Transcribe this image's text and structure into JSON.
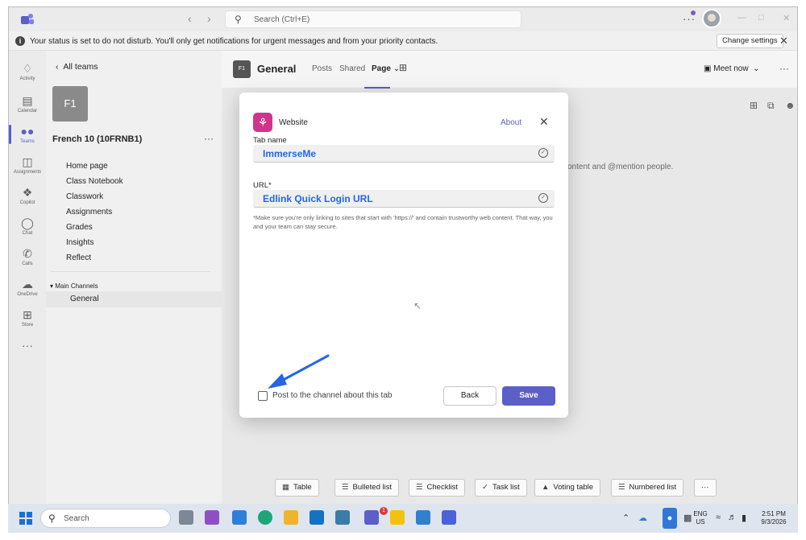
{
  "titlebar": {
    "search_placeholder": "Search (Ctrl+E)",
    "more": "···"
  },
  "banner": {
    "message": "Your status is set to do not disturb. You'll only get notifications for urgent messages and from your priority contacts.",
    "change_settings": "Change settings"
  },
  "rail": {
    "items": [
      {
        "label": "Activity",
        "icon": "bell-icon"
      },
      {
        "label": "Calendar",
        "icon": "calendar-icon"
      },
      {
        "label": "Teams",
        "icon": "teams-icon"
      },
      {
        "label": "Assignments",
        "icon": "backpack-icon"
      },
      {
        "label": "Copilot",
        "icon": "copilot-icon"
      },
      {
        "label": "Chat",
        "icon": "chat-icon"
      },
      {
        "label": "Calls",
        "icon": "phone-icon"
      },
      {
        "label": "OneDrive",
        "icon": "cloud-icon"
      },
      {
        "label": "Store",
        "icon": "plus-icon"
      }
    ],
    "more": "···"
  },
  "team_panel": {
    "all_teams": "All teams",
    "tile": "F1",
    "team_name": "French 10 (10FRNB1)",
    "more": "···",
    "items": [
      "Home page",
      "Class Notebook",
      "Classwork",
      "Assignments",
      "Grades",
      "Insights",
      "Reflect"
    ],
    "main_channels": "Main Channels",
    "channel": "General"
  },
  "channel_header": {
    "tile": "F1",
    "title": "General",
    "tabs": [
      "Posts",
      "Shared",
      "Page"
    ],
    "meet_now": "Meet now",
    "more": "···"
  },
  "background_text": "ontent and @mention people.",
  "format_bar": [
    {
      "label": "Table",
      "icon": "table-icon"
    },
    {
      "label": "Bulleted list",
      "icon": "bullet-list-icon"
    },
    {
      "label": "Checklist",
      "icon": "checklist-icon"
    },
    {
      "label": "Task list",
      "icon": "task-list-icon"
    },
    {
      "label": "Voting table",
      "icon": "voting-icon"
    },
    {
      "label": "Numbered list",
      "icon": "numbered-list-icon"
    },
    {
      "label": "···",
      "icon": "more-icon"
    }
  ],
  "dialog": {
    "title": "Website",
    "about": "About",
    "tab_name_label": "Tab name",
    "tab_name_value": "ImmerseMe",
    "url_label": "URL*",
    "url_value": "Edlink Quick Login URL",
    "help_text": "*Make sure you're only linking to sites that start with 'https://' and contain trustworthy web content. That way, you and your team can stay secure.",
    "checkbox_label": "Post to the channel about this tab",
    "back": "Back",
    "save": "Save"
  },
  "taskbar": {
    "search_placeholder": "Search",
    "teams_badge": "1",
    "language": "ENG",
    "region": "US",
    "time": "2:51 PM",
    "date": "9/3/2026"
  },
  "colors": {
    "accent": "#5b5fc7",
    "website_icon": "#d2348b",
    "annotation_arrow": "#2566e8"
  }
}
